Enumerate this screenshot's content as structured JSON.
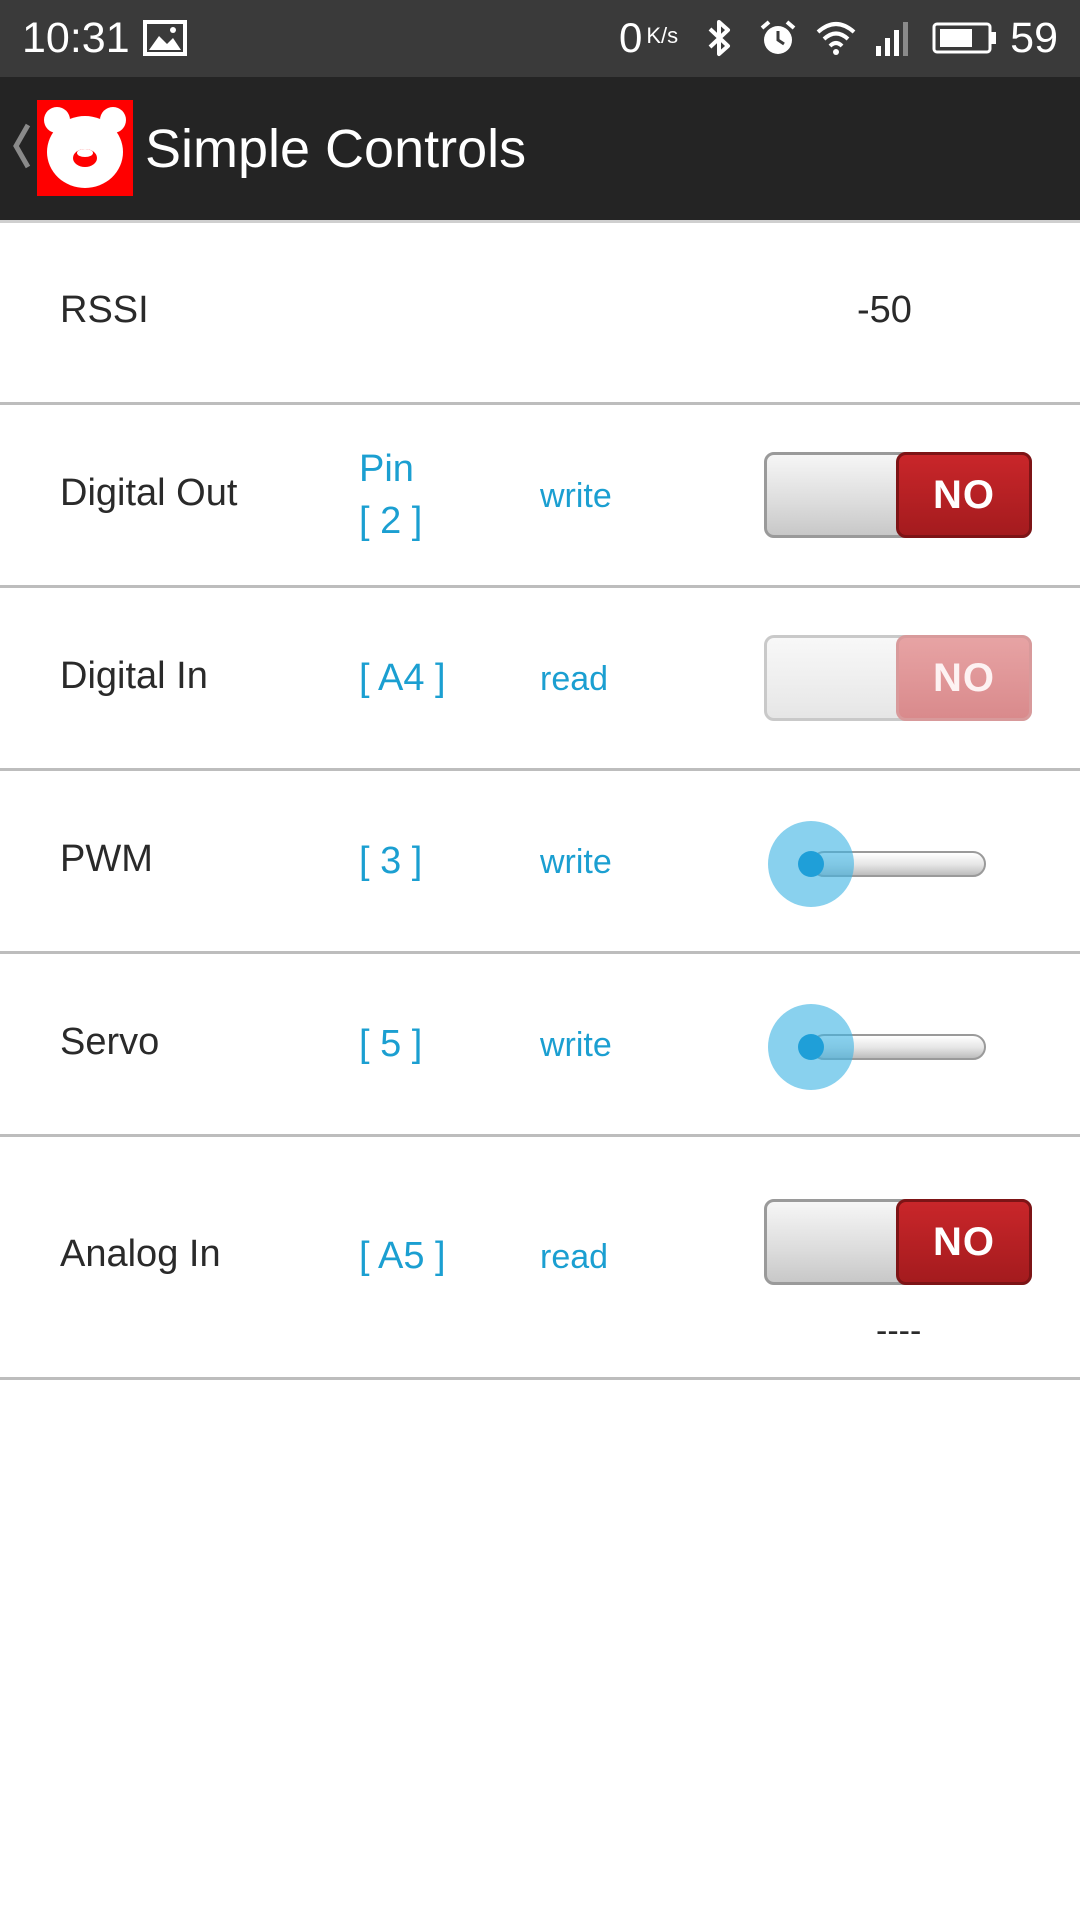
{
  "status_bar": {
    "time": "10:31",
    "net_speed": "0",
    "net_speed_unit": "K/s",
    "battery_level": "59",
    "icons": [
      "image-icon",
      "bluetooth-icon",
      "alarm-icon",
      "wifi-icon",
      "cellular-4g-icon",
      "battery-icon"
    ]
  },
  "app_bar": {
    "title": "Simple Controls",
    "logo_color": "#ff0000",
    "background": "#242424"
  },
  "rows": {
    "rssi": {
      "label": "RSSI",
      "value": "-50"
    },
    "digital_out": {
      "label": "Digital Out",
      "pin_line1": "Pin",
      "pin_line2": "[ 2 ]",
      "mode": "write",
      "toggle_text": "NO",
      "toggle_enabled": true
    },
    "digital_in": {
      "label": "Digital In",
      "pin": "[ A4 ]",
      "mode": "read",
      "toggle_text": "NO",
      "toggle_enabled": false
    },
    "pwm": {
      "label": "PWM",
      "pin": "[ 3 ]",
      "mode": "write",
      "slider_value": 0
    },
    "servo": {
      "label": "Servo",
      "pin": "[ 5 ]",
      "mode": "write",
      "slider_value": 0
    },
    "analog_in": {
      "label": "Analog In",
      "pin": "[ A5 ]",
      "mode": "read",
      "toggle_text": "NO",
      "toggle_enabled": true,
      "reading": "----"
    }
  },
  "colors": {
    "accent": "#1b9fd1",
    "toggle_off_knob": "#b32023",
    "status_bar": "#3a3a3a"
  }
}
